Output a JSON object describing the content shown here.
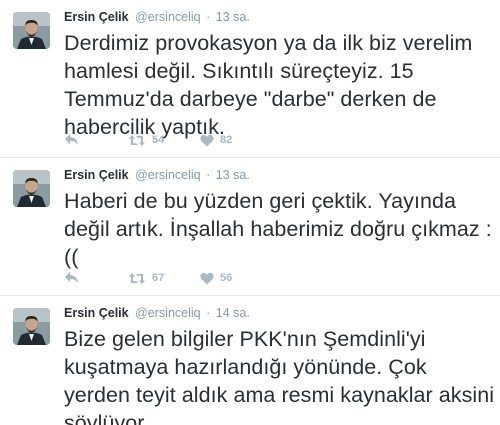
{
  "colors": {
    "text": "#292f33",
    "meta": "#8899a6",
    "action_icon": "#aab8c2",
    "divider": "#e1e8ed"
  },
  "tweets": [
    {
      "name": "Ersin Çelik",
      "handle": "@ersinceliq",
      "separator": "·",
      "time": "13 sa.",
      "lines": [
        "Derdimiz provokasyon ya da ilk biz verelim",
        "hamlesi değil. Sıkıntılı süreçteyiz. 15",
        "Temmuz'da darbeye \"darbe\" derken de",
        "habercilik yaptık."
      ],
      "retweets": "54",
      "likes": "82",
      "icons": [
        "reply-icon",
        "retweet-icon",
        "heart-icon"
      ]
    },
    {
      "name": "Ersin Çelik",
      "handle": "@ersinceliq",
      "separator": "·",
      "time": "13 sa.",
      "lines": [
        "Haberi de bu yüzden geri çektik. Yayında",
        "değil artık. İnşallah haberimiz doğru çıkmaz :",
        "(("
      ],
      "retweets": "67",
      "likes": "56",
      "icons": [
        "reply-icon",
        "retweet-icon",
        "heart-icon"
      ]
    },
    {
      "name": "Ersin Çelik",
      "handle": "@ersinceliq",
      "separator": "·",
      "time": "14 sa.",
      "lines": [
        "Bize gelen bilgiler PKK'nın Şemdinli'yi",
        "kuşatmaya hazırlandığı yönünde. Çok",
        "yerden teyit aldık ama resmi kaynaklar aksini",
        "söylüyor."
      ]
    }
  ]
}
